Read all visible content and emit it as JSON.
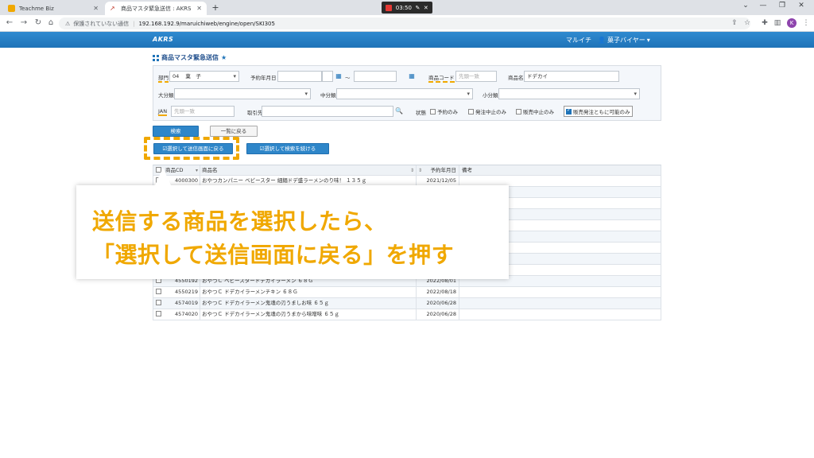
{
  "browser": {
    "tabs": [
      {
        "title": "Teachme Biz",
        "active": false
      },
      {
        "title": "商品マスタ緊急送信 : AKRS",
        "active": true
      }
    ],
    "new_tab": "+",
    "recorder_time": "03:50",
    "address": {
      "security_text": "保護されていない通信",
      "url": "192.168.192.9/maruichiweb/engine/open/SKI305"
    },
    "profile_initial": "K"
  },
  "app": {
    "logo": "AKRS",
    "org": "マルイチ",
    "user": "菓子バイヤー",
    "page_title": "商品マスタ緊急送信"
  },
  "search": {
    "dept_label": "部門",
    "dept_code": "04",
    "dept_name": "菓　子",
    "date_label": "予約年月日",
    "date_from": "",
    "tilde": "～",
    "date_to": "",
    "code_label": "商品コード",
    "code_placeholder": "先頭一致",
    "name_label": "商品名",
    "name_value": "ドデカイ",
    "major_label": "大分類",
    "middle_label": "中分類",
    "minor_label": "小分類",
    "jan_label": "JAN",
    "jan_placeholder": "先頭一致",
    "supplier_label": "取引先",
    "state_label": "状態",
    "state_options": [
      {
        "label": "予約のみ",
        "checked": false
      },
      {
        "label": "発注中止のみ",
        "checked": false
      },
      {
        "label": "販売中止のみ",
        "checked": false
      },
      {
        "label": "販売発注ともに可能のみ",
        "checked": true
      }
    ]
  },
  "buttons": {
    "search": "検索",
    "list_back": "一覧に戻る",
    "select_and_return": "☑選択して送信画面に戻る",
    "select_and_continue": "☑選択して検索を続ける"
  },
  "table": {
    "headers": {
      "code": "商品CD",
      "name": "商品名",
      "date": "予約年月日",
      "note": "備考"
    },
    "rows": [
      {
        "code": "4000300",
        "name": "おやつカンパニー ベビースター 細麺ドデ盛ラーメンのり味！ １３５ｇ",
        "date": "2021/12/05",
        "note": ""
      },
      {
        "code": "",
        "name": "",
        "date": "",
        "note": ""
      },
      {
        "code": "",
        "name": "",
        "date": "",
        "note": ""
      },
      {
        "code": "",
        "name": "",
        "date": "",
        "note": ""
      },
      {
        "code": "",
        "name": "",
        "date": "",
        "note": ""
      },
      {
        "code": "",
        "name": "",
        "date": "",
        "note": ""
      },
      {
        "code": "",
        "name": "",
        "date": "",
        "note": ""
      },
      {
        "code": "",
        "name": "",
        "date": "",
        "note": ""
      },
      {
        "code": "",
        "name": "",
        "date": "",
        "note": ""
      },
      {
        "code": "4550192",
        "name": "おやつＣ ベビースタードデカイラーメン ６８Ｇ",
        "date": "2022/08/01",
        "note": ""
      },
      {
        "code": "4550219",
        "name": "おやつＣ ドデカイラーメンチキン ６８Ｇ",
        "date": "2022/08/18",
        "note": ""
      },
      {
        "code": "4574019",
        "name": "おやつＣ ドデカイラーメン鬼魂の刃うましお味 ６５ｇ",
        "date": "2020/06/28",
        "note": ""
      },
      {
        "code": "4574020",
        "name": "おやつＣ ドデカイラーメン鬼魂の刃うまから味噌味 ６５ｇ",
        "date": "2020/06/28",
        "note": ""
      }
    ]
  },
  "caption": {
    "line1": "送信する商品を選択したら、",
    "line2": "「選択して送信画面に戻る」を押す"
  },
  "colors": {
    "accent_orange": "#f0a800",
    "header_blue": "#1f73b8",
    "button_blue": "#2e86c9"
  }
}
